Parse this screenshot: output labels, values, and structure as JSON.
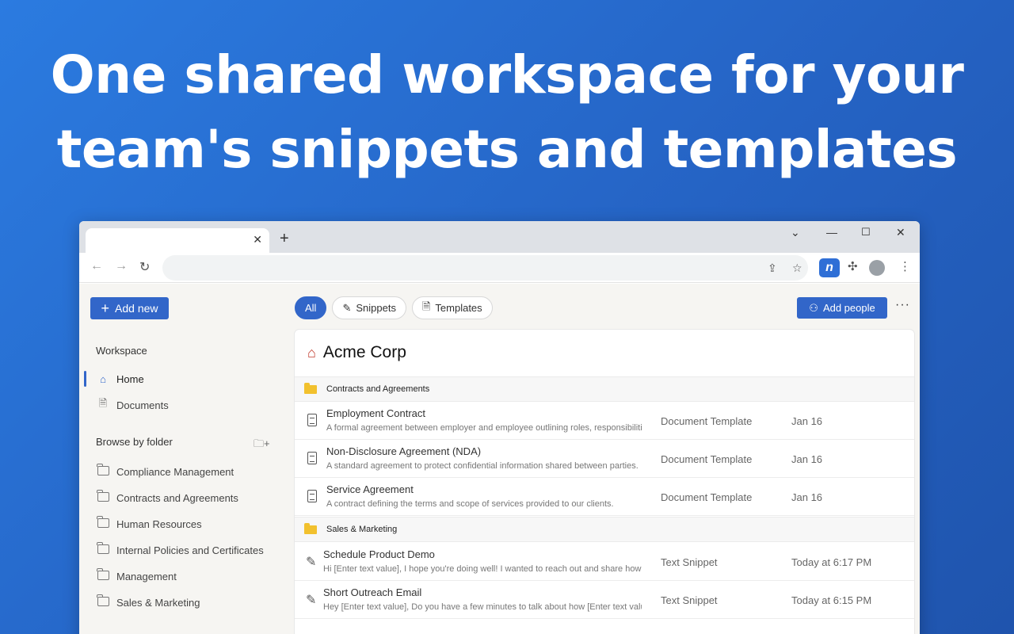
{
  "headline": {
    "line1": "One shared workspace for your",
    "line2": "team's snippets and templates"
  },
  "browser": {
    "tab_close": "✕",
    "new_tab": "+",
    "address_value": "",
    "ext_letter": "n"
  },
  "sidebar": {
    "add_new_label": "Add new",
    "workspace_heading": "Workspace",
    "nav": [
      {
        "label": "Home",
        "icon": "home-icon"
      },
      {
        "label": "Documents",
        "icon": "documents-icon"
      }
    ],
    "browse_heading": "Browse by folder",
    "folders": [
      "Compliance Management",
      "Contracts and Agreements",
      "Human Resources",
      "Internal Policies and Certificates",
      "Management",
      "Sales & Marketing"
    ]
  },
  "toolbar": {
    "filters": [
      "All",
      "Snippets",
      "Templates"
    ],
    "add_people_label": "Add people",
    "more_label": "···"
  },
  "panel": {
    "workspace_name": "Acme Corp",
    "groups": [
      {
        "name": "Contracts and Agreements",
        "items": [
          {
            "title": "Employment Contract",
            "desc": "A formal agreement between employer and employee outlining roles, responsibiliti",
            "type": "Document Template",
            "date": "Jan 16"
          },
          {
            "title": "Non-Disclosure Agreement (NDA)",
            "desc": "A standard agreement to protect confidential information shared between parties.",
            "type": "Document Template",
            "date": "Jan 16"
          },
          {
            "title": "Service Agreement",
            "desc": "A contract defining the terms and scope of services provided to our clients.",
            "type": "Document Template",
            "date": "Jan 16"
          }
        ]
      },
      {
        "name": "Sales & Marketing",
        "items": [
          {
            "title": "Schedule Product Demo",
            "desc": "Hi [Enter text value], I hope you're doing well! I wanted to reach out and share how",
            "type": "Text Snippet",
            "date": "Today at 6:17 PM"
          },
          {
            "title": "Short Outreach Email",
            "desc": "Hey [Enter text value], Do you have a few minutes to talk about how [Enter text valu",
            "type": "Text Snippet",
            "date": "Today at 6:15 PM"
          }
        ]
      }
    ]
  }
}
